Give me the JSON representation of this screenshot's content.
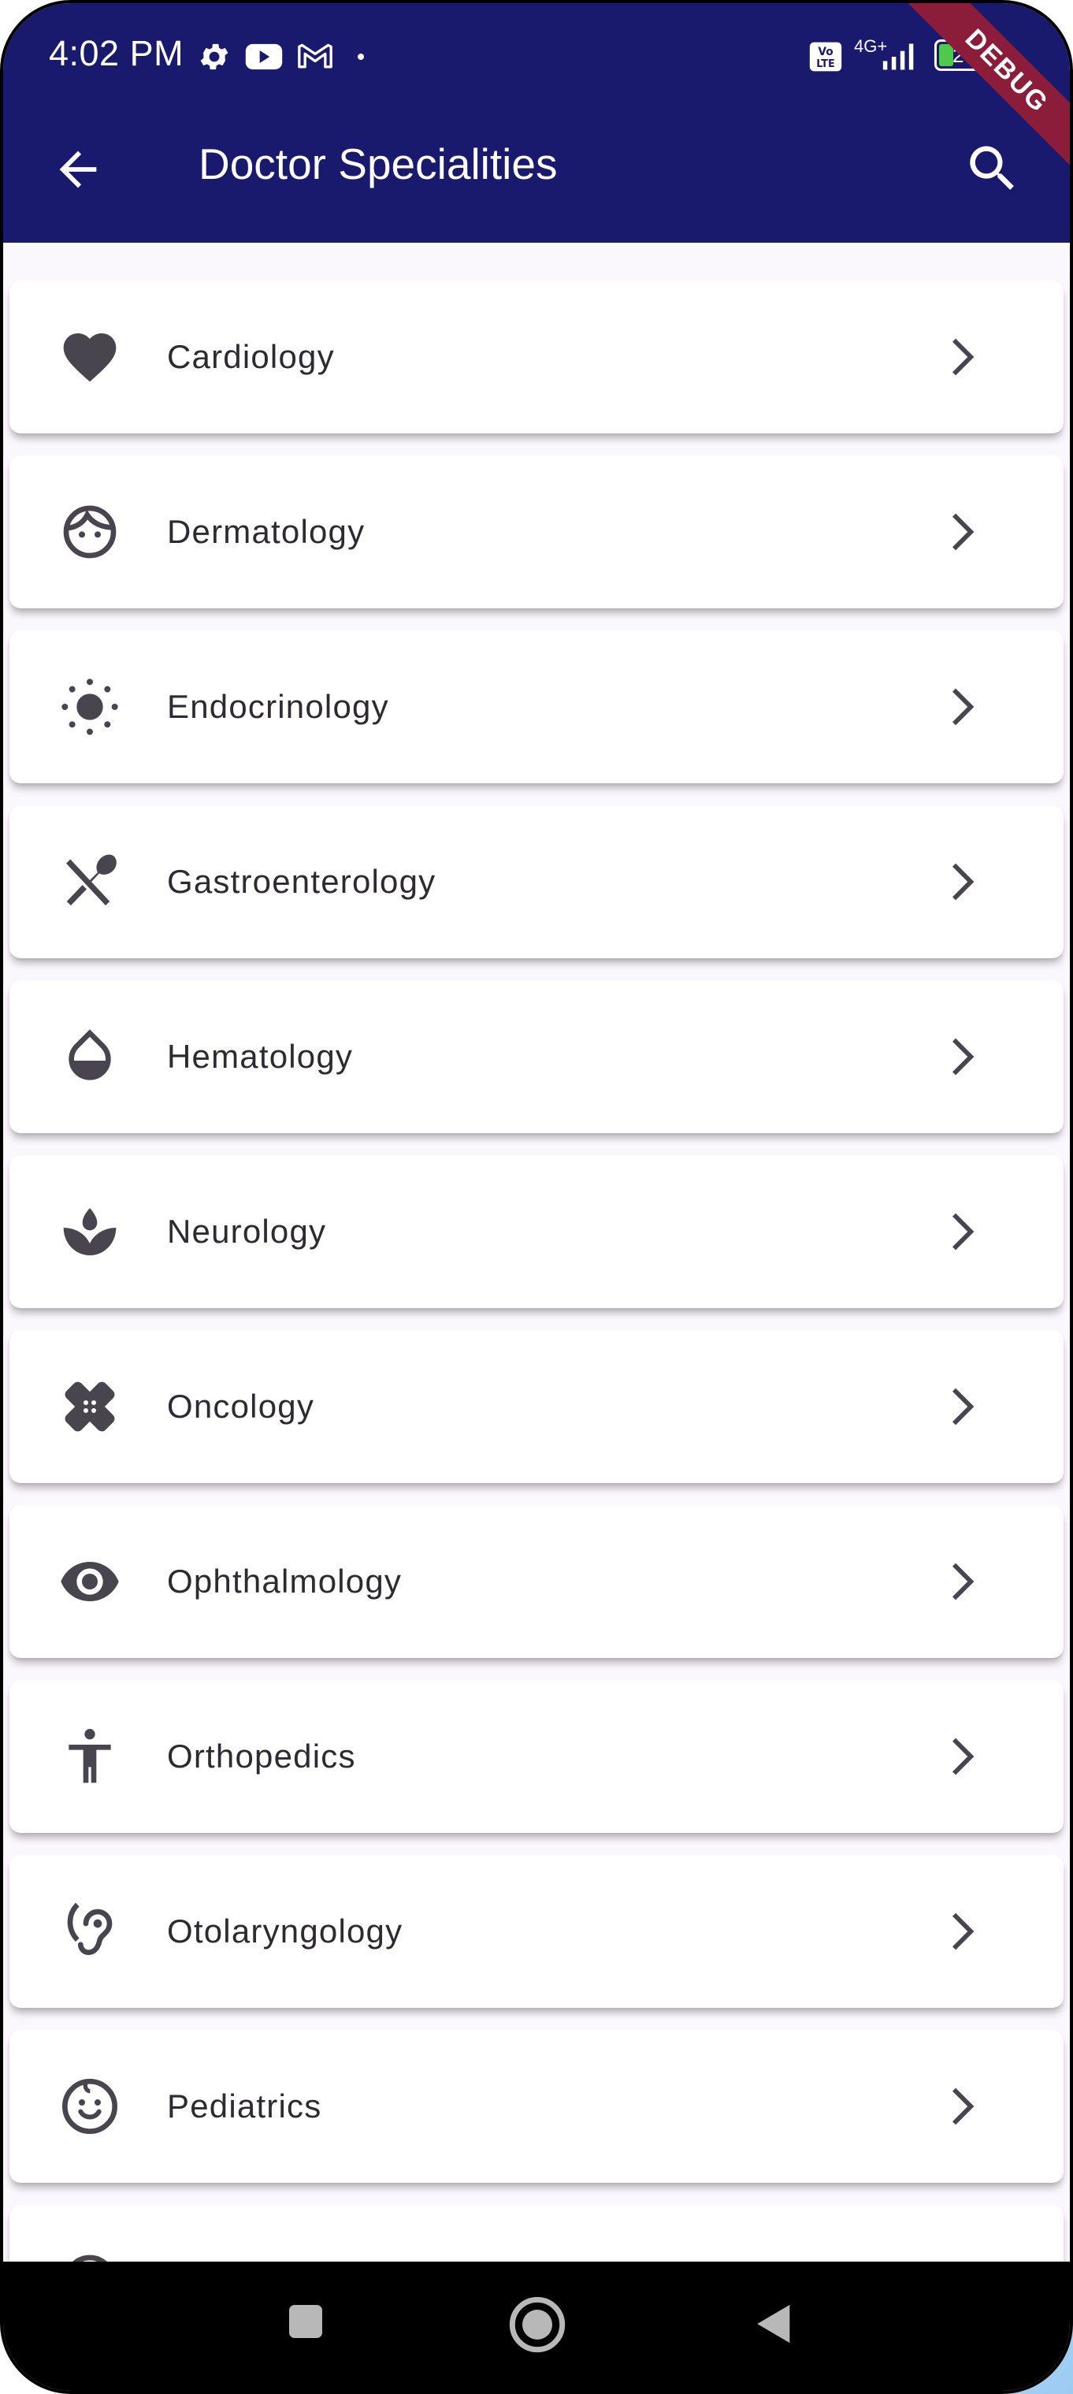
{
  "status_bar": {
    "time": "4:02 PM",
    "battery": "26",
    "network": "4G+",
    "debug_badge": "DEBUG"
  },
  "app_bar": {
    "title": "Doctor Specialities"
  },
  "specialities": [
    {
      "label": "Cardiology",
      "icon": "heart-icon"
    },
    {
      "label": "Dermatology",
      "icon": "face-icon"
    },
    {
      "label": "Endocrinology",
      "icon": "sun-icon"
    },
    {
      "label": "Gastroenterology",
      "icon": "fork-spoon-icon"
    },
    {
      "label": "Hematology",
      "icon": "water-drop-icon"
    },
    {
      "label": "Neurology",
      "icon": "spa-icon"
    },
    {
      "label": "Oncology",
      "icon": "bandage-icon"
    },
    {
      "label": "Ophthalmology",
      "icon": "eye-icon"
    },
    {
      "label": "Orthopedics",
      "icon": "accessibility-icon"
    },
    {
      "label": "Otolaryngology",
      "icon": "hearing-icon"
    },
    {
      "label": "Pediatrics",
      "icon": "baby-face-icon"
    }
  ],
  "colors": {
    "app_bar": "#19196e",
    "icon": "#48454e",
    "label": "#2d2a31"
  }
}
